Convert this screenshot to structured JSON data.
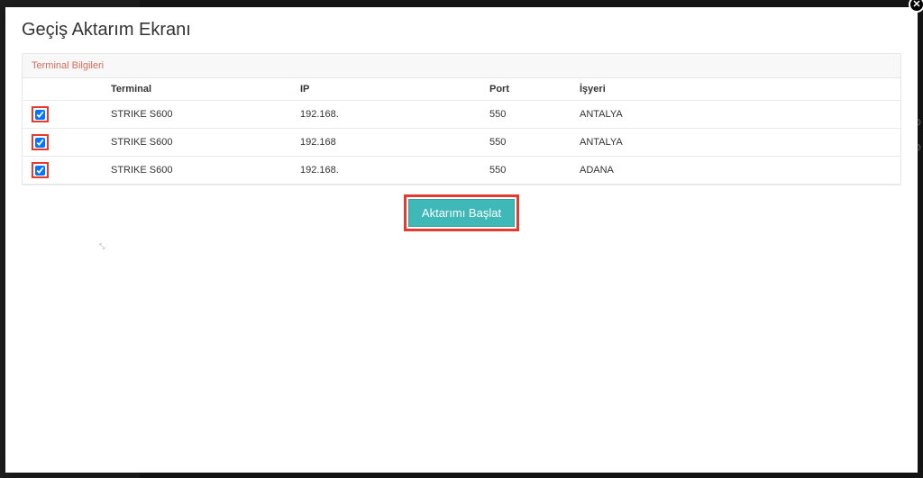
{
  "modal": {
    "title": "Geçiş Aktarım Ekranı",
    "panel_title": "Terminal Bilgileri",
    "columns": {
      "terminal": "Terminal",
      "ip": "IP",
      "port": "Port",
      "isyeri": "İşyeri"
    },
    "rows": [
      {
        "checked": true,
        "terminal": "STRIKE S600",
        "ip": "192.168.",
        "port": "550",
        "isyeri": "ANTALYA"
      },
      {
        "checked": true,
        "terminal": "STRIKE S600",
        "ip": "192.168",
        "port": "550",
        "isyeri": "ANTALYA"
      },
      {
        "checked": true,
        "terminal": "STRIKE S600",
        "ip": "192.168.",
        "port": "550",
        "isyeri": "ADANA"
      }
    ],
    "start_button_label": "Aktarımı Başlat",
    "close_symbol": "✕"
  },
  "colors": {
    "highlight": "#e63a2f",
    "button_bg": "#3fb8b8",
    "panel_title_color": "#d86a5a"
  }
}
